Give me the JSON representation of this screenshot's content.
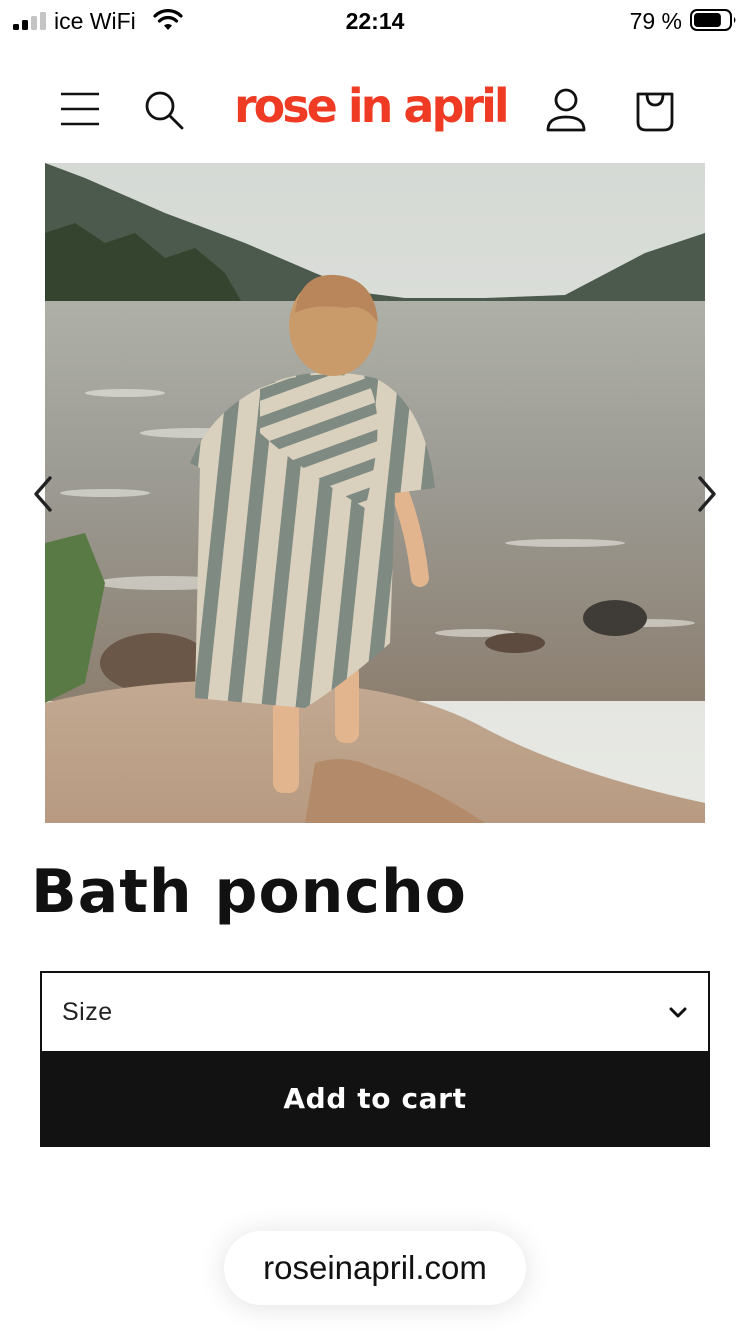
{
  "status_bar": {
    "carrier": "ice WiFi",
    "time": "22:14",
    "battery_text": "79 %",
    "battery_level": 0.79,
    "signal_bars_filled": 2,
    "icons": [
      "signal-icon",
      "wifi-icon",
      "battery-icon"
    ]
  },
  "header": {
    "logo_text": "rose in april",
    "logo_color": "#ef3b24",
    "icons": [
      "menu-icon",
      "search-icon",
      "account-icon",
      "cart-icon"
    ]
  },
  "gallery": {
    "prev_icon": "chevron-left-icon",
    "next_icon": "chevron-right-icon"
  },
  "product": {
    "title": "Bath poncho"
  },
  "size_select": {
    "label": "Size",
    "icon": "chevron-down-icon"
  },
  "add_to_cart": {
    "label": "Add to cart",
    "bg_color": "#121212"
  },
  "browser": {
    "url": "roseinapril.com"
  }
}
